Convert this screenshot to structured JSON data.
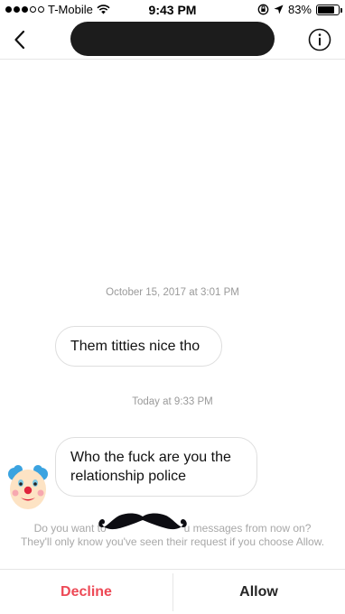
{
  "status_bar": {
    "carrier": "T-Mobile",
    "time": "9:43 PM",
    "battery": "83%",
    "battery_level": 0.83,
    "icons": [
      "signal-dots-icon",
      "wifi-icon",
      "orientation-lock-icon",
      "location-icon",
      "battery-icon"
    ]
  },
  "nav": {
    "back_icon": "chevron-left-icon",
    "info_icon": "info-icon"
  },
  "conversation": {
    "timestamp_1": "October 15, 2017 at 3:01 PM",
    "message_1": "Them titties nice tho",
    "timestamp_2": "Today at 9:33 PM",
    "message_2_line_1": "Who the fuck are you the",
    "message_2_line_2": "relationship police",
    "avatar_icon": "clown-face-icon",
    "overlay_icon": "mustache-icon"
  },
  "request": {
    "line_1_before": "Do you want to",
    "line_1_after": "u messages from now on?",
    "line_2": "They'll only know you've seen their request if you choose Allow."
  },
  "actions": {
    "decline": "Decline",
    "allow": "Allow"
  },
  "colors": {
    "decline": "#ed4956",
    "allow": "#262626",
    "timestamp": "#9a9a9a"
  }
}
